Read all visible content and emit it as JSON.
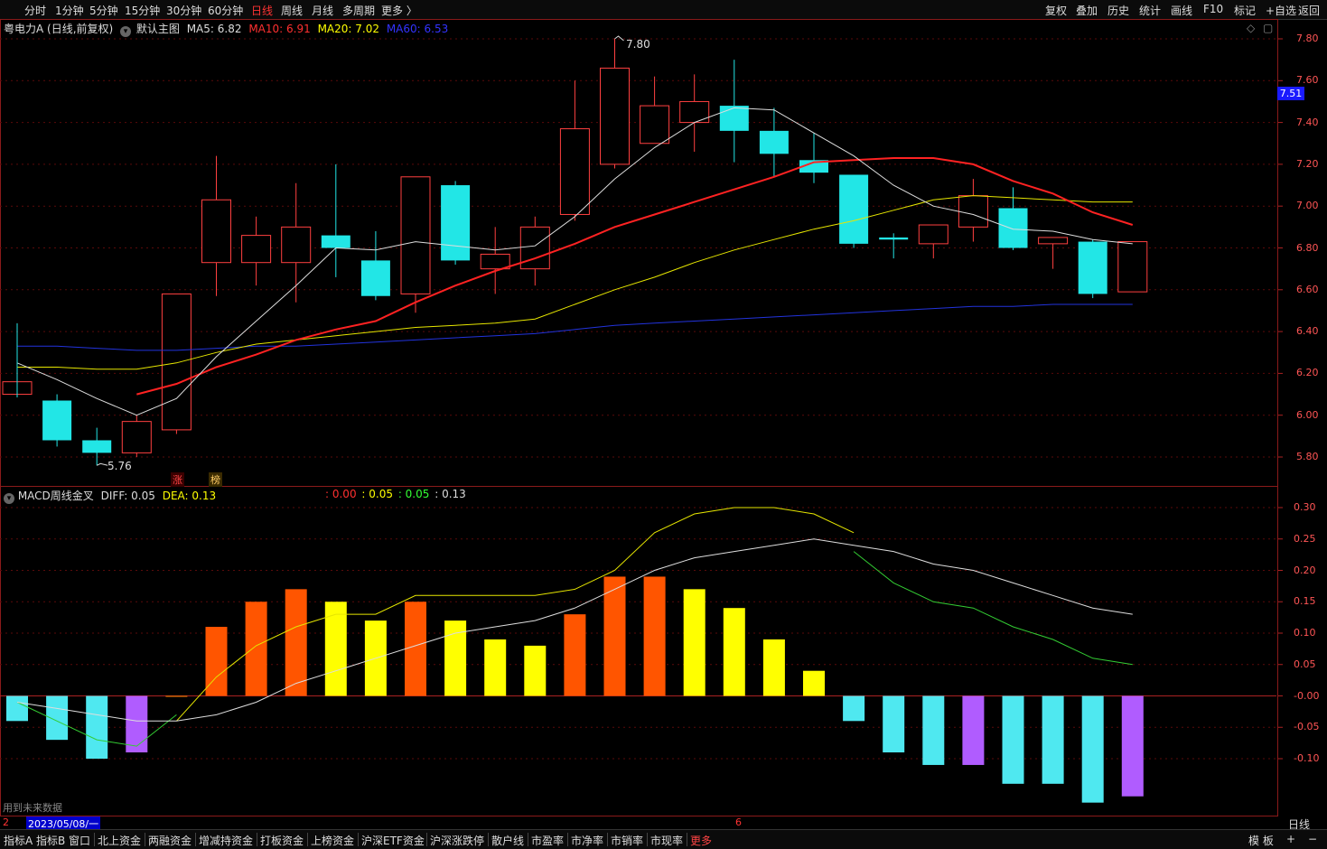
{
  "toolbar_left": [
    "分时",
    "1分钟",
    "5分钟",
    "15分钟",
    "30分钟",
    "60分钟",
    "日线",
    "周线",
    "月线",
    "多周期",
    "更多 〉"
  ],
  "toolbar_active": "日线",
  "toolbar_right": [
    "复权",
    "叠加",
    "历史",
    "统计",
    "画线",
    "F10",
    "标记",
    "+自选",
    "返回"
  ],
  "main_legend": {
    "stock": "粤电力A (日线,前复权)",
    "template": "默认主图",
    "ma5": "MA5: 6.82",
    "ma10": "MA10: 6.91",
    "ma20": "MA20: 7.02",
    "ma60": "MA60: 6.53"
  },
  "price_axis": [
    "7.80",
    "7.60",
    "7.40",
    "7.20",
    "7.00",
    "6.80",
    "6.60",
    "6.40",
    "6.20",
    "6.00",
    "5.80"
  ],
  "current_price": "7.51",
  "high_mark": "7.80",
  "low_mark": "5.76",
  "badges": [
    "涨",
    "榜"
  ],
  "macd_legend": {
    "name": "MACD周线金叉",
    "diff": "DIFF: 0.05",
    "dea": "DEA: 0.13",
    "v1": ": 0.00",
    "v2": ": 0.05",
    "v3": ": 0.05",
    "v4": ": 0.13"
  },
  "macd_axis": [
    "0.30",
    "0.25",
    "0.20",
    "0.15",
    "0.10",
    "0.05",
    "-0.00",
    "-0.05",
    "-0.10"
  ],
  "future_data_note": "用到未来数据",
  "date_cursor": "2023/05/08/一",
  "date_left_digit": "2",
  "date_mid_digit": "6",
  "period_label": "日线",
  "bottom_tabs": [
    "指标A",
    "指标B",
    "窗口",
    "北上资金",
    "两融资金",
    "增减持资金",
    "打板资金",
    "上榜资金",
    "沪深ETF资金",
    "沪深涨跌停",
    "散户线",
    "市盈率",
    "市净率",
    "市销率",
    "市现率",
    "更多"
  ],
  "bottom_right": [
    "模 板",
    "+",
    "−"
  ],
  "chart_data": {
    "type": "candlestick",
    "price_ylim": [
      5.7,
      7.85
    ],
    "candles": [
      {
        "o": 6.1,
        "c": 6.16,
        "h": 6.44,
        "l": 6.1
      },
      {
        "o": 6.07,
        "c": 5.88,
        "h": 6.1,
        "l": 5.85
      },
      {
        "o": 5.88,
        "c": 5.82,
        "h": 5.94,
        "l": 5.76
      },
      {
        "o": 5.82,
        "c": 5.97,
        "h": 6.0,
        "l": 5.8
      },
      {
        "o": 5.93,
        "c": 6.58,
        "h": 6.58,
        "l": 5.91
      },
      {
        "o": 6.73,
        "c": 7.03,
        "h": 7.24,
        "l": 6.57
      },
      {
        "o": 6.73,
        "c": 6.86,
        "h": 6.95,
        "l": 6.62
      },
      {
        "o": 6.73,
        "c": 6.9,
        "h": 7.11,
        "l": 6.54
      },
      {
        "o": 6.86,
        "c": 6.8,
        "h": 7.2,
        "l": 6.66
      },
      {
        "o": 6.74,
        "c": 6.57,
        "h": 6.88,
        "l": 6.55
      },
      {
        "o": 6.58,
        "c": 7.14,
        "h": 7.14,
        "l": 6.49
      },
      {
        "o": 7.1,
        "c": 6.74,
        "h": 7.12,
        "l": 6.72
      },
      {
        "o": 6.7,
        "c": 6.77,
        "h": 6.9,
        "l": 6.58
      },
      {
        "o": 6.7,
        "c": 6.9,
        "h": 6.95,
        "l": 6.62
      },
      {
        "o": 6.96,
        "c": 7.37,
        "h": 7.6,
        "l": 6.93
      },
      {
        "o": 7.2,
        "c": 7.66,
        "h": 7.8,
        "l": 7.18
      },
      {
        "o": 7.3,
        "c": 7.48,
        "h": 7.62,
        "l": 7.3
      },
      {
        "o": 7.4,
        "c": 7.5,
        "h": 7.63,
        "l": 7.26
      },
      {
        "o": 7.48,
        "c": 7.36,
        "h": 7.7,
        "l": 7.21
      },
      {
        "o": 7.36,
        "c": 7.25,
        "h": 7.47,
        "l": 7.14
      },
      {
        "o": 7.22,
        "c": 7.16,
        "h": 7.35,
        "l": 7.11
      },
      {
        "o": 7.15,
        "c": 6.82,
        "h": 7.15,
        "l": 6.8
      },
      {
        "o": 6.85,
        "c": 6.84,
        "h": 6.87,
        "l": 6.75
      },
      {
        "o": 6.82,
        "c": 6.91,
        "h": 6.91,
        "l": 6.75
      },
      {
        "o": 6.9,
        "c": 7.05,
        "h": 7.13,
        "l": 6.83
      },
      {
        "o": 6.99,
        "c": 6.8,
        "h": 7.09,
        "l": 6.79
      },
      {
        "o": 6.82,
        "c": 6.85,
        "h": 6.85,
        "l": 6.7
      },
      {
        "o": 6.83,
        "c": 6.58,
        "h": 6.84,
        "l": 6.56
      },
      {
        "o": 6.59,
        "c": 6.83,
        "h": 6.83,
        "l": 6.59
      }
    ],
    "ma5": [
      6.25,
      6.17,
      6.08,
      6.0,
      6.08,
      6.28,
      6.45,
      6.62,
      6.8,
      6.79,
      6.83,
      6.81,
      6.79,
      6.81,
      6.95,
      7.13,
      7.28,
      7.4,
      7.47,
      7.46,
      7.35,
      7.24,
      7.1,
      7.0,
      6.96,
      6.89,
      6.88,
      6.84,
      6.82
    ],
    "ma10": [
      6.23,
      null,
      null,
      6.1,
      6.15,
      6.23,
      6.29,
      6.36,
      6.41,
      6.45,
      6.54,
      6.62,
      6.69,
      6.75,
      6.82,
      6.9,
      6.96,
      7.02,
      7.08,
      7.14,
      7.21,
      7.22,
      7.23,
      7.23,
      7.2,
      7.12,
      7.06,
      6.97,
      6.91
    ],
    "ma20": [
      6.23,
      6.23,
      6.22,
      6.22,
      6.25,
      6.3,
      6.34,
      6.36,
      6.38,
      6.4,
      6.42,
      6.43,
      6.44,
      6.46,
      6.53,
      6.6,
      6.66,
      6.73,
      6.79,
      6.84,
      6.89,
      6.93,
      6.98,
      7.03,
      7.05,
      7.04,
      7.03,
      7.02,
      7.02
    ],
    "ma60": [
      6.33,
      6.33,
      6.32,
      6.31,
      6.31,
      6.32,
      6.33,
      6.33,
      6.34,
      6.35,
      6.36,
      6.37,
      6.38,
      6.39,
      6.41,
      6.43,
      6.44,
      6.45,
      6.46,
      6.47,
      6.48,
      6.49,
      6.5,
      6.51,
      6.52,
      6.52,
      6.53,
      6.53,
      6.53
    ],
    "macd_ylim": [
      -0.17,
      0.33
    ],
    "macd_bars": [
      -0.04,
      -0.07,
      -0.1,
      -0.09,
      0.0,
      0.11,
      0.15,
      0.17,
      0.15,
      0.12,
      0.15,
      0.12,
      0.09,
      0.08,
      0.13,
      0.19,
      0.19,
      0.17,
      0.14,
      0.09,
      0.04,
      -0.04,
      -0.09,
      -0.11,
      -0.11,
      -0.14,
      -0.14,
      -0.17,
      -0.16
    ],
    "macd_bar_colors": [
      "#4fe8f0",
      "#4fe8f0",
      "#4fe8f0",
      "#b05cff",
      "#ff8800",
      "#ff5500",
      "#ff5500",
      "#ff5500",
      "#ffff00",
      "#ffff00",
      "#ff5500",
      "#ffff00",
      "#ffff00",
      "#ffff00",
      "#ff5500",
      "#ff5500",
      "#ff5500",
      "#ffff00",
      "#ffff00",
      "#ffff00",
      "#ffff00",
      "#4fe8f0",
      "#4fe8f0",
      "#4fe8f0",
      "#b05cff",
      "#4fe8f0",
      "#4fe8f0",
      "#4fe8f0",
      "#b05cff"
    ],
    "macd_white": [
      -0.01,
      -0.02,
      -0.03,
      -0.04,
      -0.04,
      -0.03,
      -0.01,
      0.02,
      0.04,
      0.06,
      0.08,
      0.1,
      0.11,
      0.12,
      0.14,
      0.17,
      0.2,
      0.22,
      0.23,
      0.24,
      0.25,
      0.24,
      0.23,
      0.21,
      0.2,
      0.18,
      0.16,
      0.14,
      0.13
    ],
    "macd_yellow": [
      null,
      null,
      null,
      null,
      -0.04,
      0.03,
      0.08,
      0.11,
      0.13,
      0.13,
      0.16,
      0.16,
      0.16,
      0.16,
      0.17,
      0.2,
      0.26,
      0.29,
      0.3,
      0.3,
      0.29,
      0.26,
      null,
      null,
      null,
      null,
      null,
      null,
      null
    ],
    "macd_green": [
      -0.01,
      -0.04,
      -0.07,
      -0.08,
      -0.03,
      null,
      null,
      null,
      null,
      null,
      null,
      null,
      null,
      null,
      null,
      null,
      null,
      null,
      null,
      null,
      null,
      0.23,
      0.18,
      0.15,
      0.14,
      0.11,
      0.09,
      0.06,
      0.05
    ]
  }
}
